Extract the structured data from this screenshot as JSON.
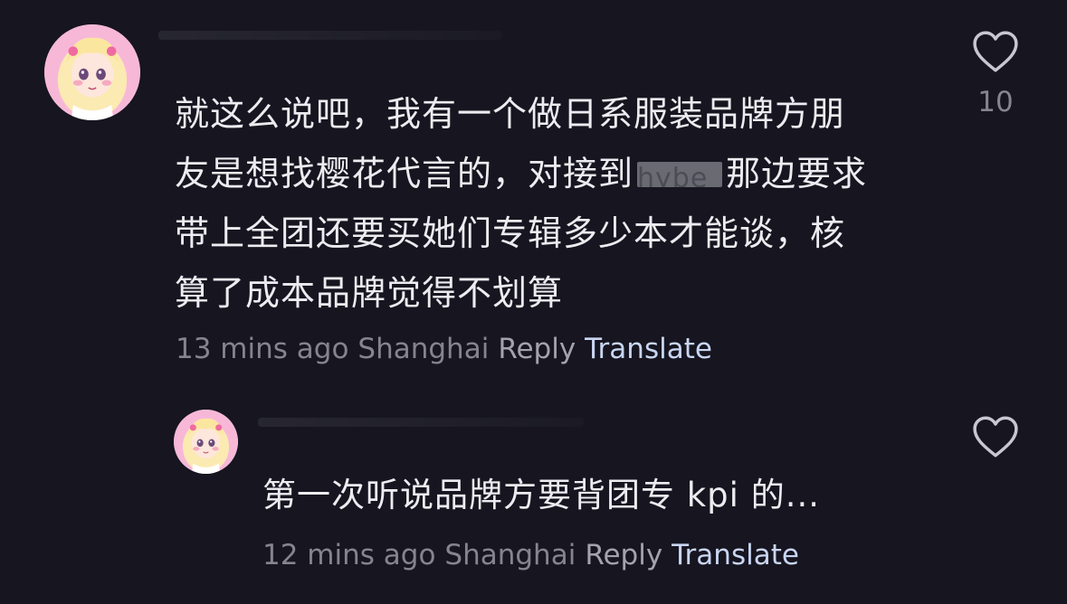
{
  "comments": [
    {
      "lines": [
        "就这么说吧，我有一个做日系服装品牌方朋",
        "友是想找樱花代言的，对接到",
        "那边要求",
        "带上全团还要买她们专辑多少本才能谈，核",
        "算了成本品牌觉得不划算"
      ],
      "redacted_word": "hybe",
      "time": "13 mins ago",
      "location": "Shanghai",
      "reply_label": "Reply",
      "translate_label": "Translate",
      "like_count": "10",
      "like_icon": "heart-outline-icon",
      "avatar_icon": "anime-girl-avatar"
    },
    {
      "text": "第一次听说品牌方要背团专 kpi 的...",
      "time": "12 mins ago",
      "location": "Shanghai",
      "reply_label": "Reply",
      "translate_label": "Translate",
      "like_icon": "heart-outline-icon",
      "avatar_icon": "anime-girl-avatar"
    }
  ],
  "colors": {
    "background": "#161520",
    "text": "#ececf0",
    "meta": "#85848f",
    "translate": "#c9d6f2"
  }
}
